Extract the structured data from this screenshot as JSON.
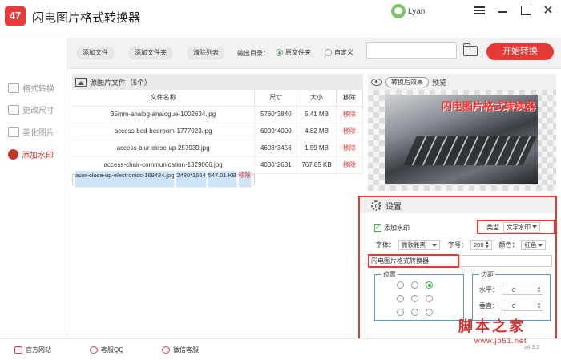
{
  "app": {
    "title": "闪电图片格式转换器",
    "logo_text": "47",
    "user": "Lyan"
  },
  "sidebar": {
    "items": [
      {
        "label": "格式转换",
        "active": false
      },
      {
        "label": "更改尺寸",
        "active": false
      },
      {
        "label": "美化图片",
        "active": false
      },
      {
        "label": "添加水印",
        "active": true
      }
    ]
  },
  "toolbar": {
    "add_file": "添加文件",
    "add_folder": "添加文件夹",
    "clear_list": "清除列表",
    "output_label": "输出目录：",
    "radio_source": "原文件夹",
    "radio_custom": "自定义",
    "path_value": "",
    "start": "开始转换"
  },
  "files": {
    "header": "源图片文件（5个）",
    "columns": [
      "文件名称",
      "尺寸",
      "大小",
      "移除"
    ],
    "rows": [
      {
        "name": "35mm-analog-analogue-1002634.jpg",
        "size": "5760*3840",
        "filesize": "5.41 MB",
        "remove": "移除"
      },
      {
        "name": "access-bed-bedroom-1777023.jpg",
        "size": "6000*4000",
        "filesize": "4.82 MB",
        "remove": "移除"
      },
      {
        "name": "access-blur-close-up-257930.jpg",
        "size": "4608*3456",
        "filesize": "1.59 MB",
        "remove": "移除"
      },
      {
        "name": "access-chair-communication-1329066.jpg",
        "size": "4000*2631",
        "filesize": "767.85 KB",
        "remove": "移除"
      },
      {
        "name": "acer-close-up-electronics-169484.jpg",
        "size": "2480*1664",
        "filesize": "547.01 KB",
        "remove": "移除",
        "selected": true
      }
    ]
  },
  "preview": {
    "toggle_label": "转换后效果",
    "label": "预览",
    "watermark": "闪电图片格式转换器"
  },
  "settings": {
    "title": "设置",
    "add_watermark": "添加水印",
    "type_label": "类型",
    "type_value": "文字水印",
    "font_label": "字体：",
    "font_value": "微软雅黑",
    "size_label": "字号：",
    "size_value": "200",
    "color_label": "颜色：",
    "color_value": "红色",
    "text_value": "闪电图片格式转换器",
    "position_label": "位置",
    "position_selected": 2,
    "margin_label": "边距",
    "horizontal_label": "水平：",
    "horizontal_value": "0",
    "vertical_label": "垂直：",
    "vertical_value": "0"
  },
  "footer": {
    "website": "官方网站",
    "qq": "客服QQ",
    "wechat": "微信客服",
    "brand": "脚本之家",
    "brand_url": "www.jb51.net",
    "version": "v4.3.2"
  },
  "colors": {
    "accent": "#e53935",
    "selected_row": "#cde5f7",
    "check_green": "#4caf50"
  }
}
